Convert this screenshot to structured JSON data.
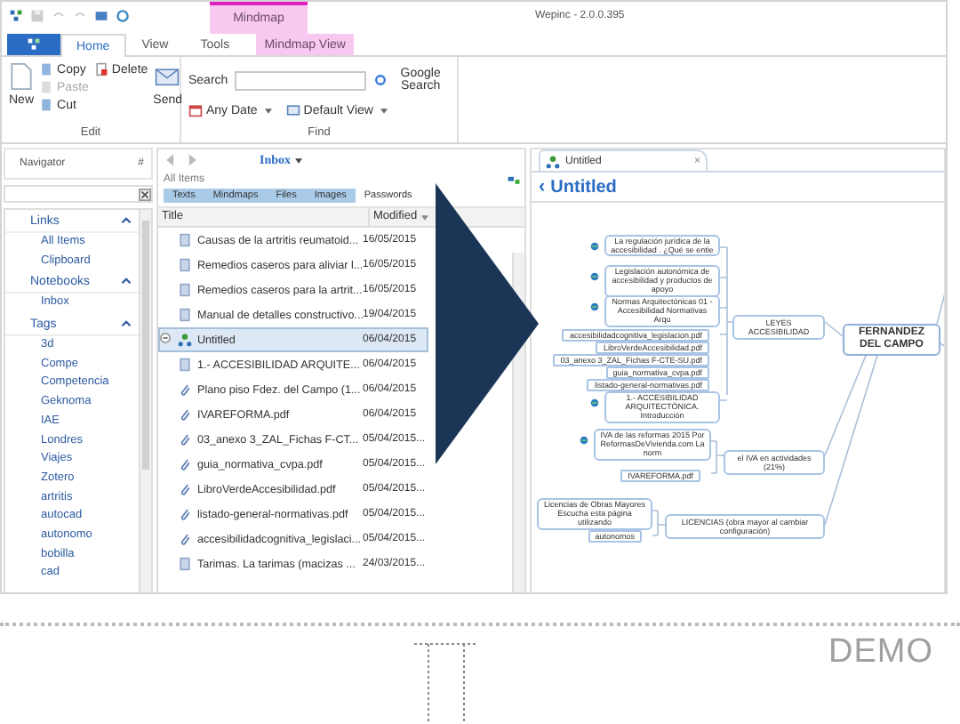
{
  "window": {
    "title": "Wepinc - 2.0.0.395",
    "contextual_tab_group": "Mindmap"
  },
  "ribbon_tabs": [
    {
      "label": "Home",
      "selected": true,
      "kind": "normal"
    },
    {
      "label": "View",
      "selected": false,
      "kind": "normal"
    },
    {
      "label": "Tools",
      "selected": false,
      "kind": "normal"
    },
    {
      "label": "Mindmap View",
      "selected": false,
      "kind": "contextual"
    }
  ],
  "ribbon": {
    "edit_group": {
      "label": "Edit",
      "new": "New",
      "copy": {
        "label": "Copy",
        "disabled": false
      },
      "paste": {
        "label": "Paste",
        "disabled": true
      },
      "delete": {
        "label": "Delete",
        "disabled": false
      },
      "cut": {
        "label": "Cut",
        "disabled": false
      },
      "send": "Send"
    },
    "find_group": {
      "label": "Find",
      "search_label": "Search",
      "google_search": "Google Search",
      "date_filter": "Any Date",
      "view_filter": "Default View"
    }
  },
  "navigator": {
    "title": "Navigator",
    "pin": "#",
    "sections": [
      {
        "title": "Links",
        "expanded": true,
        "items": [
          "All Items",
          "Clipboard"
        ]
      },
      {
        "title": "Notebooks",
        "expanded": true,
        "items": [
          "Inbox"
        ]
      },
      {
        "title": "Tags",
        "expanded": true,
        "items": [
          "3d",
          "Compe",
          "Competencia",
          "Geknoma",
          "IAE",
          "Londres",
          "Viajes",
          "Zotero",
          "artritis",
          "autocad",
          "autonomo",
          "bobilla",
          "cad"
        ]
      }
    ]
  },
  "list": {
    "breadcrumb": "Inbox",
    "scope": "All Items",
    "filters": [
      {
        "label": "Texts",
        "selected": true
      },
      {
        "label": "Mindmaps",
        "selected": true
      },
      {
        "label": "Files",
        "selected": true
      },
      {
        "label": "Images",
        "selected": true
      },
      {
        "label": "Passwords",
        "selected": false
      }
    ],
    "columns": [
      "Title",
      "Modified"
    ],
    "rows": [
      {
        "kind": "note",
        "title": "Causas de la artritis reumatoid...",
        "modified": "16/05/2015",
        "selected": false
      },
      {
        "kind": "note",
        "title": "Remedios caseros para aliviar l...",
        "modified": "16/05/2015",
        "selected": false
      },
      {
        "kind": "note",
        "title": "Remedios caseros para la artrit...",
        "modified": "16/05/2015",
        "selected": false
      },
      {
        "kind": "note",
        "title": "Manual de detalles constructivo...",
        "modified": "19/04/2015",
        "selected": false
      },
      {
        "kind": "mindmap",
        "title": "Untitled",
        "modified": "06/04/2015",
        "selected": true
      },
      {
        "kind": "note",
        "title": "1.- ACCESIBILIDAD ARQUITE...",
        "modified": "06/04/2015",
        "selected": false
      },
      {
        "kind": "file",
        "title": "Plano piso Fdez. del Campo (1...",
        "modified": "06/04/2015",
        "selected": false
      },
      {
        "kind": "file",
        "title": "IVAREFORMA.pdf",
        "modified": "06/04/2015",
        "selected": false
      },
      {
        "kind": "file",
        "title": "03_anexo 3_ZAL_Fichas F-CT...",
        "modified": "05/04/2015...",
        "selected": false
      },
      {
        "kind": "file",
        "title": "guia_normativa_cvpa.pdf",
        "modified": "05/04/2015...",
        "selected": false
      },
      {
        "kind": "file",
        "title": "LibroVerdeAccesibilidad.pdf",
        "modified": "05/04/2015...",
        "selected": false
      },
      {
        "kind": "file",
        "title": "listado-general-normativas.pdf",
        "modified": "05/04/2015...",
        "selected": false
      },
      {
        "kind": "file",
        "title": "accesibilidadcognitiva_legislaci...",
        "modified": "05/04/2015...",
        "selected": false
      },
      {
        "kind": "note",
        "title": "Tarimas. La tarimas (macizas ...",
        "modified": "24/03/2015...",
        "selected": false
      }
    ]
  },
  "mindmap": {
    "tab": "Untitled",
    "close": "×",
    "back": "‹",
    "heading": "Untitled",
    "nodes": [
      {
        "kind": "topic",
        "text": "La regulación jurídica de la accesibilidad . ¿Qué se entie"
      },
      {
        "kind": "topic",
        "text": "Legislación autonómica de accesibilidad y productos de apoyo"
      },
      {
        "kind": "topic",
        "text": "Normas Arquitectónicas 01 - Accesibilidad Normativas Arqu"
      },
      {
        "kind": "file",
        "text": "accesibilidadcognitiva_legislacion.pdf"
      },
      {
        "kind": "file",
        "text": "LibroVerdeAccesibilidad.pdf"
      },
      {
        "kind": "file",
        "text": "03_anexo 3_ZAL_Fichas F-CTE-SU.pdf"
      },
      {
        "kind": "file",
        "text": "guia_normativa_cvpa.pdf"
      },
      {
        "kind": "file",
        "text": "listado-general-normativas.pdf"
      },
      {
        "kind": "topic",
        "text": "1.- ACCESIBILIDAD ARQUITECTÓNICA. Introducción"
      },
      {
        "kind": "branch",
        "text": "LEYES ACCESIBILIDAD"
      },
      {
        "kind": "central",
        "text": "FERNANDEZ DEL CAMPO"
      },
      {
        "kind": "topic",
        "text": "IVA de las reformas 2015 Por ReformasDeVivienda.com La norm"
      },
      {
        "kind": "file",
        "text": "IVAREFORMA.pdf"
      },
      {
        "kind": "branch",
        "text": "el IVA en actividades (21%)"
      },
      {
        "kind": "topic",
        "text": "Licencias de Obras Mayores Escucha esta página utilizando"
      },
      {
        "kind": "file",
        "text": "autonomos"
      },
      {
        "kind": "branch",
        "text": "LICENCIAS (obra mayor al cambiar configuración)"
      }
    ]
  },
  "footer": {
    "label": "DEMO"
  }
}
